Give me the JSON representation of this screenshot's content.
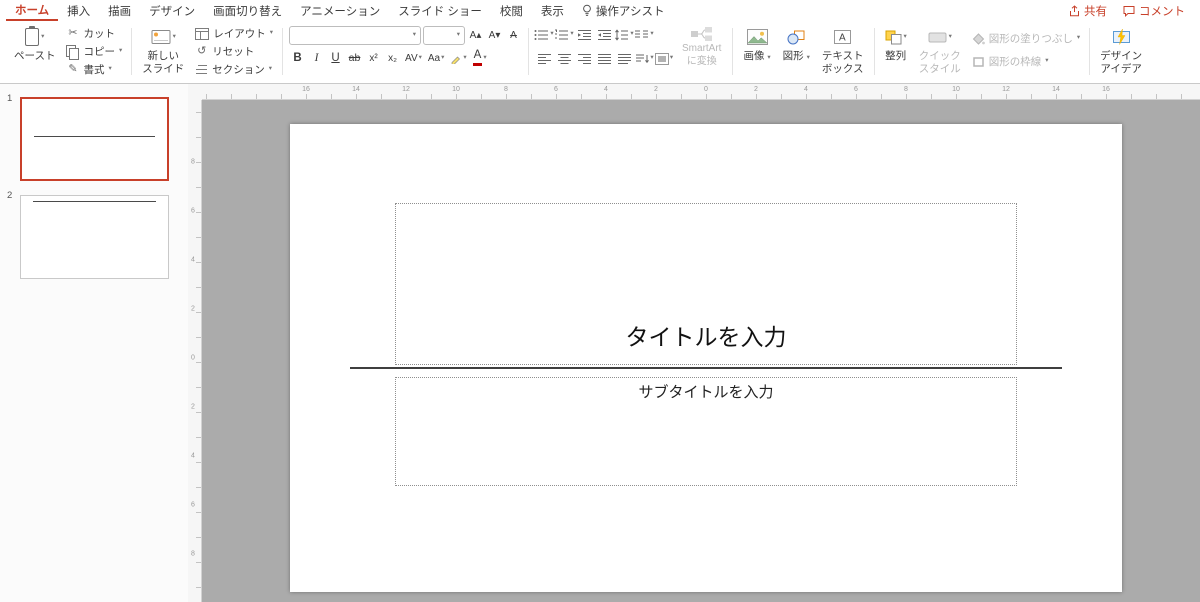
{
  "colors": {
    "accent": "#c8402a",
    "workspace": "#ababab"
  },
  "glyphs": {
    "chevron": "▾",
    "cut": "✂",
    "reset": "↺",
    "brush": "✎"
  },
  "menubar": {
    "tabs": [
      "ホーム",
      "挿入",
      "描画",
      "デザイン",
      "画面切り替え",
      "アニメーション",
      "スライド ショー",
      "校閲",
      "表示",
      "操作アシスト"
    ],
    "share": "共有",
    "comments": "コメント"
  },
  "ribbon": {
    "paste": "ペースト",
    "cut": "カット",
    "copy": "コピー",
    "format_painter": "書式",
    "new_slide_line1": "新しい",
    "new_slide_line2": "スライド",
    "layout": "レイアウト",
    "reset": "リセット",
    "section": "セクション",
    "font_name": "",
    "font_size": "",
    "grow_font": "A▴",
    "shrink_font": "A▾",
    "clear_format": "A",
    "bold": "B",
    "italic": "I",
    "underline": "U",
    "strikethrough": "ab",
    "superscript": "x²",
    "subscript": "x₂",
    "char_spacing": "AV",
    "change_case": "Aa",
    "font_color": "A",
    "smartart_line1": "SmartArt",
    "smartart_line2": "に変換",
    "picture": "画像",
    "shapes": "図形",
    "textbox_line1": "テキスト",
    "textbox_line2": "ボックス",
    "arrange": "整列",
    "quick_line1": "クイック",
    "quick_line2": "スタイル",
    "shape_fill": "図形の塗りつぶし",
    "shape_outline": "図形の枠線",
    "design_line1": "デザイン",
    "design_line2": "アイデア"
  },
  "slides_panel": {
    "slides": [
      {
        "number": "1"
      },
      {
        "number": "2"
      }
    ]
  },
  "slide": {
    "title_placeholder": "タイトルを入力",
    "subtitle_placeholder": "サブタイトルを入力"
  },
  "ruler": {
    "h_numbers": [
      "16",
      "14",
      "12",
      "10",
      "8",
      "6",
      "4",
      "2",
      "0",
      "2",
      "4",
      "6",
      "8",
      "10",
      "12",
      "14",
      "16"
    ],
    "v_numbers": [
      "8",
      "6",
      "4",
      "2",
      "0",
      "2",
      "4",
      "6",
      "8"
    ]
  }
}
